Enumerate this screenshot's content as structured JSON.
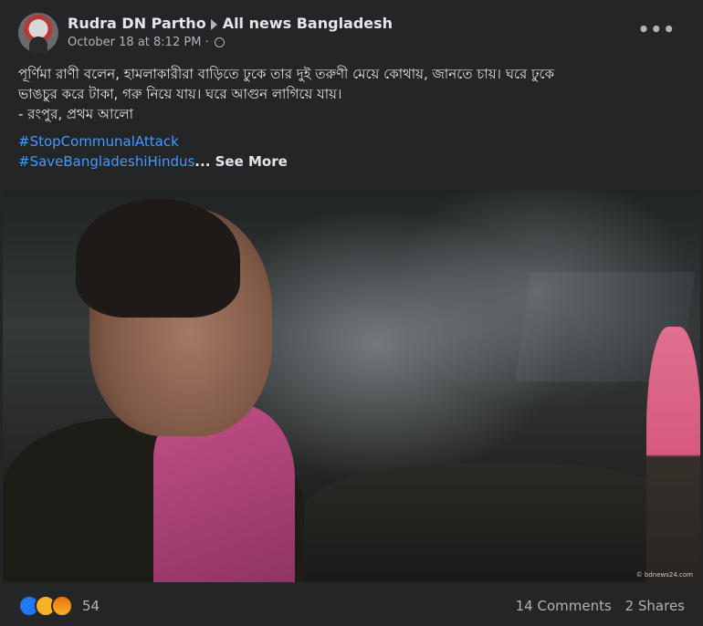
{
  "post": {
    "author": "Rudra DN Partho",
    "group": "All news Bangladesh",
    "timestamp": "October 18 at 8:12 PM",
    "privacy_icon": "globe-icon",
    "menu_label": "•••",
    "text_line1": "পূর্ণিমা রাণী বলেন, হামলাকারীরা বাড়িতে ঢুকে তার দুই তরুণী মেয়ে কোথায়, জানতে চায়। ঘরে ঢুকে",
    "text_line2": "ভাঙচুর করে টাকা, গরু নিয়ে যায়। ঘরে আগুন লাগিয়ে যায়।",
    "text_line3": "- রংপুর, প্রথম আলো",
    "hashtags": [
      "#StopCommunalAttack",
      "#SaveBangladeshiHindus"
    ],
    "see_more": "... See More",
    "watermark": "© bdnews24.com"
  },
  "footer": {
    "reactions": [
      "like-icon",
      "sad-icon",
      "angry-icon"
    ],
    "reaction_count": "54",
    "comments": "14 Comments",
    "shares": "2 Shares"
  },
  "colors": {
    "background": "#242526",
    "text": "#e4e6eb",
    "secondary_text": "#b0b3b8",
    "link": "#4599ff"
  }
}
